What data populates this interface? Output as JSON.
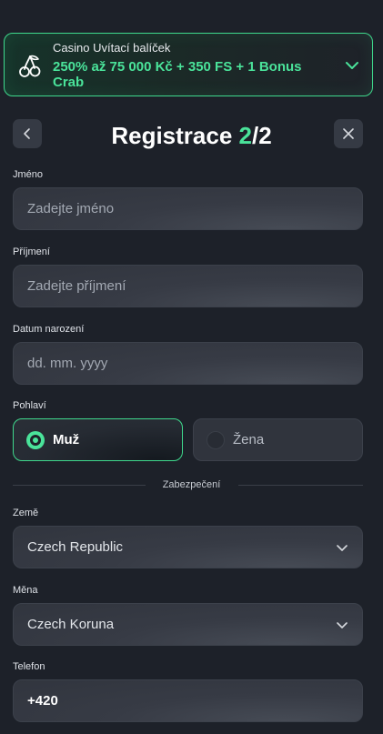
{
  "promo": {
    "title": "Casino Uvítací balíček",
    "offer": "250% až 75 000 Kč + 350 FS + 1 Bonus Crab",
    "icon": "cherry-icon",
    "accent": "#4ae39a"
  },
  "header": {
    "title_prefix": "Registrace ",
    "step_current": "2",
    "step_total": "/2"
  },
  "fields": {
    "first_name": {
      "label": "Jméno",
      "placeholder": "Zadejte jméno"
    },
    "last_name": {
      "label": "Příjmení",
      "placeholder": "Zadejte příjmení"
    },
    "birth_date": {
      "label": "Datum narození",
      "placeholder": "dd. mm. yyyy"
    },
    "gender": {
      "label": "Pohlaví",
      "options": [
        {
          "label": "Muž",
          "selected": true
        },
        {
          "label": "Žena",
          "selected": false
        }
      ]
    },
    "country": {
      "label": "Země",
      "value": "Czech Republic"
    },
    "currency": {
      "label": "Měna",
      "value": "Czech Koruna"
    },
    "phone": {
      "label": "Telefon",
      "value": "+420"
    }
  },
  "divider": {
    "label": "Zabezpečení"
  },
  "colors": {
    "background": "#1d2129",
    "accent": "#4ae39a",
    "field": "#373b45"
  }
}
